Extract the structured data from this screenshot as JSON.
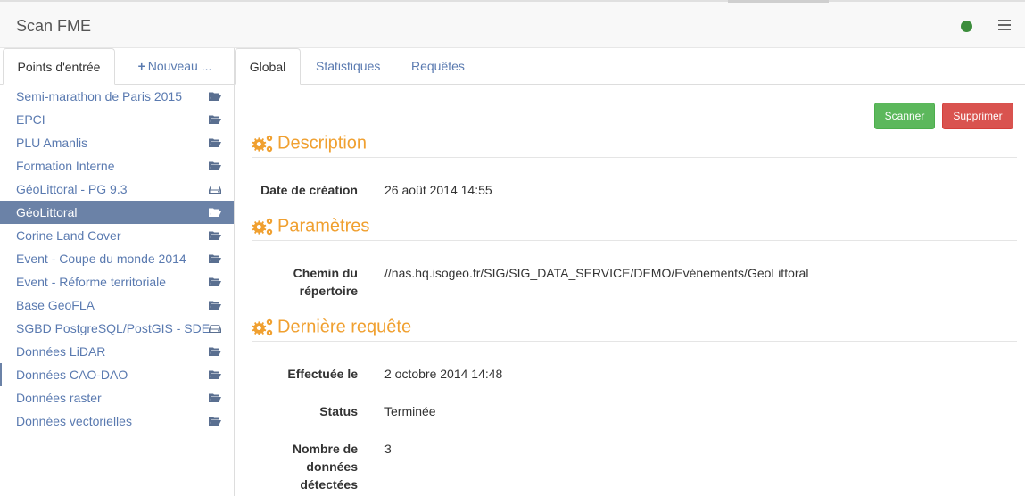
{
  "app": {
    "title": "Scan FME",
    "status_color": "#3c8d3c",
    "status_icon": "status-dot-icon",
    "menu_icon": "hamburger-icon"
  },
  "left_tabs": {
    "points": "Points d'entrée",
    "new": "Nouveau ...",
    "new_icon": "plus-icon"
  },
  "entries": [
    {
      "label": "Semi-marathon de Paris 2015",
      "icon": "folder-open-icon"
    },
    {
      "label": "EPCI",
      "icon": "folder-open-icon"
    },
    {
      "label": "PLU Amanlis",
      "icon": "folder-open-icon"
    },
    {
      "label": "Formation Interne",
      "icon": "folder-open-icon"
    },
    {
      "label": "GéoLittoral - PG 9.3",
      "icon": "database-icon"
    },
    {
      "label": "GéoLittoral",
      "icon": "folder-open-icon",
      "active": true
    },
    {
      "label": "Corine Land Cover",
      "icon": "folder-open-icon"
    },
    {
      "label": "Event - Coupe du monde 2014",
      "icon": "folder-open-icon"
    },
    {
      "label": "Event - Réforme territoriale",
      "icon": "folder-open-icon"
    },
    {
      "label": "Base GeoFLA",
      "icon": "folder-open-icon"
    },
    {
      "label": "SGBD PostgreSQL/PostGIS - SDE",
      "icon": "database-icon"
    },
    {
      "label": "Données LiDAR",
      "icon": "folder-open-icon"
    },
    {
      "label": "Données CAO-DAO",
      "icon": "folder-open-icon",
      "marked": true
    },
    {
      "label": "Données raster",
      "icon": "folder-open-icon"
    },
    {
      "label": "Données vectorielles",
      "icon": "folder-open-icon"
    }
  ],
  "right_tabs": {
    "global": "Global",
    "stats": "Statistiques",
    "requests": "Requêtes"
  },
  "buttons": {
    "scan": "Scanner",
    "delete": "Supprimer"
  },
  "colors": {
    "accent": "#f0a030",
    "link": "#5a7ab0",
    "active_bg": "#6b82a7",
    "scan": "#5cb85c",
    "delete": "#d9534f"
  },
  "description": {
    "title": "Description",
    "created_label": "Date de création",
    "created_value": "26 août 2014 14:55"
  },
  "parameters": {
    "title": "Paramètres",
    "path_label_1": "Chemin du",
    "path_label_2": "répertoire",
    "path_value": "//nas.hq.isogeo.fr/SIG/SIG_DATA_SERVICE/DEMO/Evénements/GeoLittoral"
  },
  "last_request": {
    "title": "Dernière requête",
    "done_label": "Effectuée le",
    "done_value": "2 octobre 2014 14:48",
    "status_label": "Status",
    "status_value": "Terminée",
    "count_label_1": "Nombre de",
    "count_label_2": "données",
    "count_label_3": "détectées",
    "count_value": "3"
  }
}
